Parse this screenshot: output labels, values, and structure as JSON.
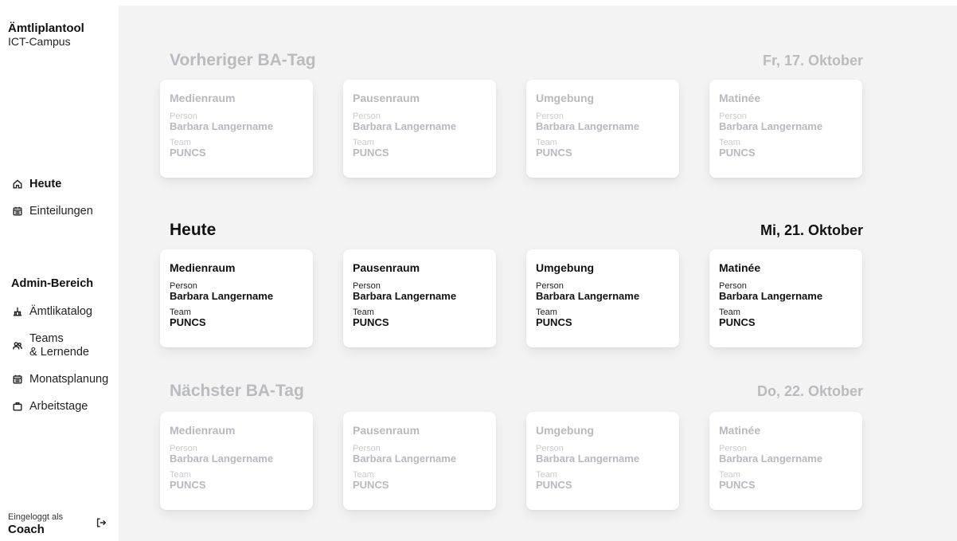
{
  "brand": {
    "title": "Ämtliplantool",
    "subtitle": "ICT-Campus"
  },
  "nav": {
    "items": [
      {
        "label": "Heute",
        "icon": "home-icon",
        "active": true
      },
      {
        "label": "Einteilungen",
        "icon": "calendar-icon",
        "active": false
      }
    ],
    "admin": {
      "heading": "Admin-Bereich",
      "items": [
        {
          "label": "Ämtlikatalog",
          "icon": "catalog-icon"
        },
        {
          "label_line1": "Teams",
          "label_line2": "& Lernende",
          "icon": "users-icon"
        },
        {
          "label": "Monatsplanung",
          "icon": "calendar-icon"
        },
        {
          "label": "Arbeitstage",
          "icon": "briefcase-icon"
        }
      ]
    }
  },
  "user": {
    "caption": "Eingeloggt als",
    "role": "Coach",
    "logout_icon": "logout-icon"
  },
  "days": [
    {
      "title": "Vorheriger BA-Tag",
      "date": "Fr, 17. Oktober",
      "muted": true,
      "cards": [
        {
          "title": "Medienraum",
          "person_label": "Person",
          "person": "Barbara Langername",
          "team_label": "Team",
          "team": "PUNCS"
        },
        {
          "title": "Pausenraum",
          "person_label": "Person",
          "person": "Barbara Langername",
          "team_label": "Team",
          "team": "PUNCS"
        },
        {
          "title": "Umgebung",
          "person_label": "Person",
          "person": "Barbara Langername",
          "team_label": "Team",
          "team": "PUNCS"
        },
        {
          "title": "Matinée",
          "person_label": "Person",
          "person": "Barbara Langername",
          "team_label": "Team",
          "team": "PUNCS"
        }
      ]
    },
    {
      "title": "Heute",
      "date": "Mi, 21. Oktober",
      "muted": false,
      "cards": [
        {
          "title": "Medienraum",
          "person_label": "Person",
          "person": "Barbara Langername",
          "team_label": "Team",
          "team": "PUNCS"
        },
        {
          "title": "Pausenraum",
          "person_label": "Person",
          "person": "Barbara Langername",
          "team_label": "Team",
          "team": "PUNCS"
        },
        {
          "title": "Umgebung",
          "person_label": "Person",
          "person": "Barbara Langername",
          "team_label": "Team",
          "team": "PUNCS"
        },
        {
          "title": "Matinée",
          "person_label": "Person",
          "person": "Barbara Langername",
          "team_label": "Team",
          "team": "PUNCS"
        }
      ]
    },
    {
      "title": "Nächster BA-Tag",
      "date": "Do, 22. Oktober",
      "muted": true,
      "cards": [
        {
          "title": "Medienraum",
          "person_label": "Person",
          "person": "Barbara Langername",
          "team_label": "Team",
          "team": "PUNCS"
        },
        {
          "title": "Pausenraum",
          "person_label": "Person",
          "person": "Barbara Langername",
          "team_label": "Team",
          "team": "PUNCS"
        },
        {
          "title": "Umgebung",
          "person_label": "Person",
          "person": "Barbara Langername",
          "team_label": "Team",
          "team": "PUNCS"
        },
        {
          "title": "Matinée",
          "person_label": "Person",
          "person": "Barbara Langername",
          "team_label": "Team",
          "team": "PUNCS"
        }
      ]
    }
  ],
  "colors": {
    "main_bg": "#f3f3f4",
    "muted_text": "#b9bbbe",
    "card_bg": "#ffffff",
    "text": "#111111"
  }
}
